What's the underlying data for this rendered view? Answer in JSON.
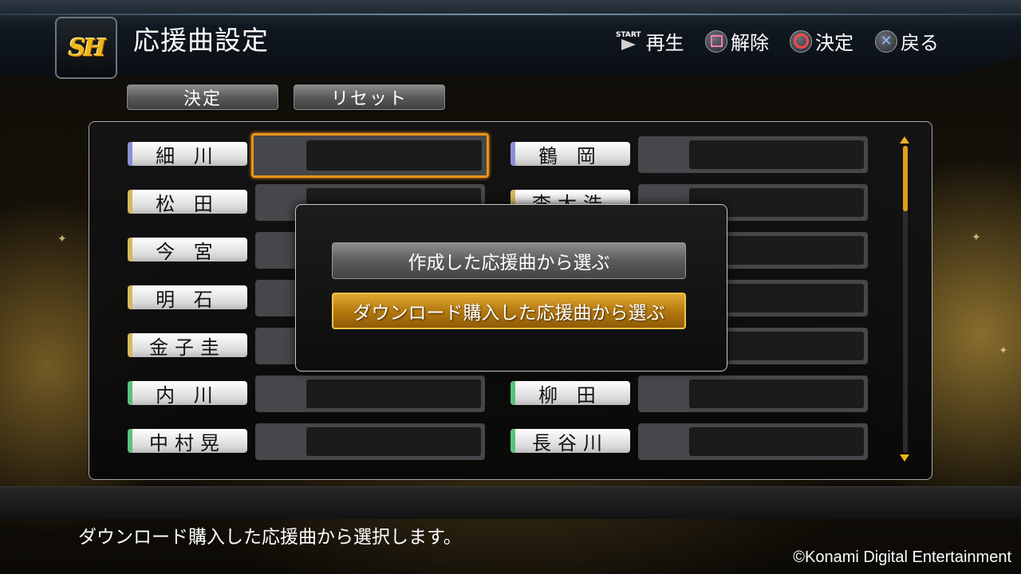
{
  "header": {
    "title": "応援曲設定",
    "logo_text": "SH",
    "hints": [
      {
        "button": "START",
        "label": "再生"
      },
      {
        "button": "square-button",
        "label": "解除"
      },
      {
        "button": "circle-button",
        "label": "決定"
      },
      {
        "button": "cross-button",
        "label": "戻る"
      }
    ]
  },
  "toolbar": {
    "confirm_label": "決定",
    "reset_label": "リセット"
  },
  "players": {
    "left": [
      {
        "name": "細 川",
        "color": "#8a8fd6"
      },
      {
        "name": "松 田",
        "color": "#d6b860"
      },
      {
        "name": "今 宮",
        "color": "#d6b860"
      },
      {
        "name": "明 石",
        "color": "#d6b860"
      },
      {
        "name": "金子圭",
        "color": "#d6b860"
      },
      {
        "name": "内 川",
        "color": "#5cc07e"
      },
      {
        "name": "中村晃",
        "color": "#5cc07e"
      }
    ],
    "right": [
      {
        "name": "鶴 岡",
        "color": "#8a8fd6"
      },
      {
        "name": "李大浩",
        "color": "#d6b860"
      },
      {
        "name": "",
        "color": "#d6b860"
      },
      {
        "name": "",
        "color": "#d6b860"
      },
      {
        "name": "",
        "color": "#d6b860"
      },
      {
        "name": "柳 田",
        "color": "#5cc07e"
      },
      {
        "name": "長谷川",
        "color": "#5cc07e"
      }
    ]
  },
  "scrollbar": {
    "position": 0.0,
    "visible_fraction": 0.22
  },
  "modal": {
    "option1": "作成した応援曲から選ぶ",
    "option2": "ダウンロード購入した応援曲から選ぶ",
    "selected_index": 1
  },
  "footer": {
    "description": "ダウンロード購入した応援曲から選択します。",
    "copyright": "©Konami Digital Entertainment"
  },
  "colors": {
    "accent_orange": "#e99417",
    "selected_button": "#b57a10"
  }
}
